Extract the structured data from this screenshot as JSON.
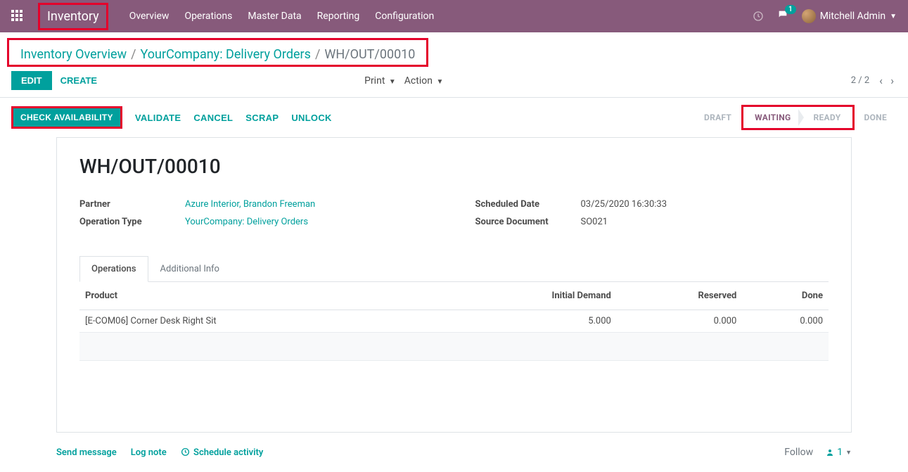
{
  "topnav": {
    "app_title": "Inventory",
    "menu": [
      "Overview",
      "Operations",
      "Master Data",
      "Reporting",
      "Configuration"
    ],
    "chat_badge": "1",
    "user_name": "Mitchell Admin"
  },
  "breadcrumbs": {
    "items": [
      "Inventory Overview",
      "YourCompany: Delivery Orders"
    ],
    "current": "WH/OUT/00010"
  },
  "toolbar": {
    "edit": "EDIT",
    "create": "CREATE",
    "print": "Print",
    "action": "Action",
    "pager": "2 / 2"
  },
  "actions": {
    "check_availability": "CHECK AVAILABILITY",
    "validate": "VALIDATE",
    "cancel": "CANCEL",
    "scrap": "SCRAP",
    "unlock": "UNLOCK"
  },
  "status": {
    "draft": "DRAFT",
    "waiting": "WAITING",
    "ready": "READY",
    "done": "DONE"
  },
  "record": {
    "name": "WH/OUT/00010",
    "partner_label": "Partner",
    "partner_value": "Azure Interior, Brandon Freeman",
    "optype_label": "Operation Type",
    "optype_value": "YourCompany: Delivery Orders",
    "sched_label": "Scheduled Date",
    "sched_value": "03/25/2020 16:30:33",
    "source_label": "Source Document",
    "source_value": "SO021"
  },
  "tabs": {
    "operations": "Operations",
    "additional": "Additional Info"
  },
  "table": {
    "headers": {
      "product": "Product",
      "initial": "Initial Demand",
      "reserved": "Reserved",
      "done": "Done"
    },
    "rows": [
      {
        "product": "[E-COM06] Corner Desk Right Sit",
        "initial": "5.000",
        "reserved": "0.000",
        "done": "0.000"
      }
    ]
  },
  "chatter": {
    "send": "Send message",
    "log": "Log note",
    "schedule": "Schedule activity",
    "follow": "Follow",
    "followers": "1"
  }
}
